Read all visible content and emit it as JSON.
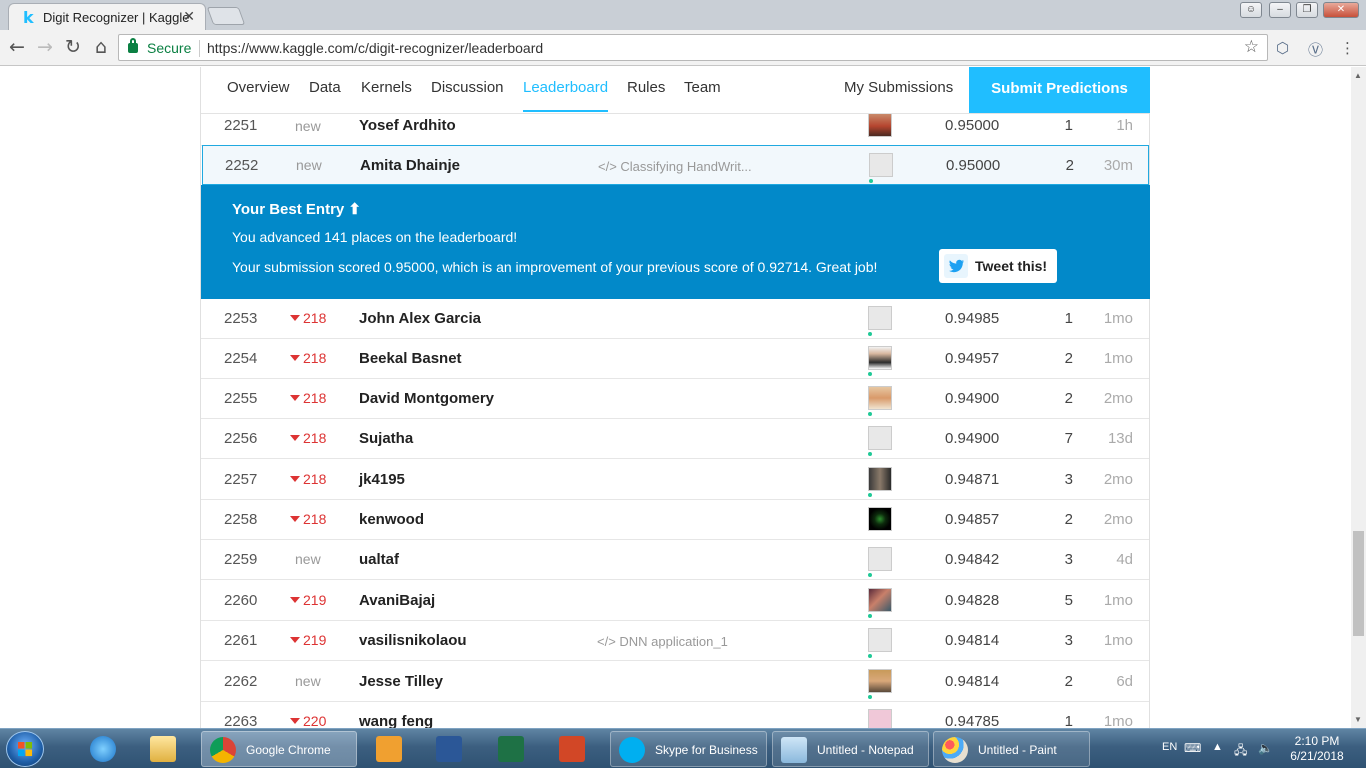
{
  "browser": {
    "tab_title": "Digit Recognizer | Kaggle",
    "tab_favicon": "k",
    "secure_label": "Secure",
    "url": "https://www.kaggle.com/c/digit-recognizer/leaderboard"
  },
  "nav": {
    "items": [
      "Overview",
      "Data",
      "Kernels",
      "Discussion",
      "Leaderboard",
      "Rules",
      "Team"
    ],
    "active": "Leaderboard",
    "my_submissions": "My Submissions",
    "submit_button": "Submit Predictions"
  },
  "rows": [
    {
      "rank": "2251",
      "change": "new",
      "name": "Yosef Ardhito",
      "kernel": "",
      "score": "0.95000",
      "entries": "1",
      "last": "1h"
    },
    {
      "rank": "2252",
      "change": "new",
      "name": "Amita Dhainje",
      "kernel": "</> Classifying HandWrit...",
      "score": "0.95000",
      "entries": "2",
      "last": "30m"
    },
    {
      "rank": "2253",
      "change": "218",
      "name": "John Alex Garcia",
      "kernel": "",
      "score": "0.94985",
      "entries": "1",
      "last": "1mo"
    },
    {
      "rank": "2254",
      "change": "218",
      "name": "Beekal Basnet",
      "kernel": "",
      "score": "0.94957",
      "entries": "2",
      "last": "1mo"
    },
    {
      "rank": "2255",
      "change": "218",
      "name": "David Montgomery",
      "kernel": "",
      "score": "0.94900",
      "entries": "2",
      "last": "2mo"
    },
    {
      "rank": "2256",
      "change": "218",
      "name": "Sujatha",
      "kernel": "",
      "score": "0.94900",
      "entries": "7",
      "last": "13d"
    },
    {
      "rank": "2257",
      "change": "218",
      "name": "jk4195",
      "kernel": "",
      "score": "0.94871",
      "entries": "3",
      "last": "2mo"
    },
    {
      "rank": "2258",
      "change": "218",
      "name": "kenwood",
      "kernel": "",
      "score": "0.94857",
      "entries": "2",
      "last": "2mo"
    },
    {
      "rank": "2259",
      "change": "new",
      "name": "ualtaf",
      "kernel": "",
      "score": "0.94842",
      "entries": "3",
      "last": "4d"
    },
    {
      "rank": "2260",
      "change": "219",
      "name": "AvaniBajaj",
      "kernel": "",
      "score": "0.94828",
      "entries": "5",
      "last": "1mo"
    },
    {
      "rank": "2261",
      "change": "219",
      "name": "vasilisnikolaou",
      "kernel": "</> DNN application_1",
      "score": "0.94814",
      "entries": "3",
      "last": "1mo"
    },
    {
      "rank": "2262",
      "change": "new",
      "name": "Jesse Tilley",
      "kernel": "",
      "score": "0.94814",
      "entries": "2",
      "last": "6d"
    },
    {
      "rank": "2263",
      "change": "220",
      "name": "wang feng",
      "kernel": "",
      "score": "0.94785",
      "entries": "1",
      "last": "1mo"
    }
  ],
  "best_entry": {
    "title": "Your Best Entry",
    "advanced": "You advanced 141 places on the leaderboard!",
    "scored": "Your submission scored 0.95000, which is an improvement of your previous score of 0.92714. Great job!",
    "tweet": "Tweet this!"
  },
  "taskbar": {
    "chrome_label": "Google Chrome",
    "skype_label": "Skype for Business",
    "notepad_label": "Untitled - Notepad",
    "paint_label": "Untitled - Paint",
    "language": "EN",
    "time": "2:10 PM",
    "date": "6/21/2018"
  },
  "colors": {
    "accent": "#20beff",
    "best_entry_bg": "#0289c9",
    "rank_down": "#d33333"
  }
}
